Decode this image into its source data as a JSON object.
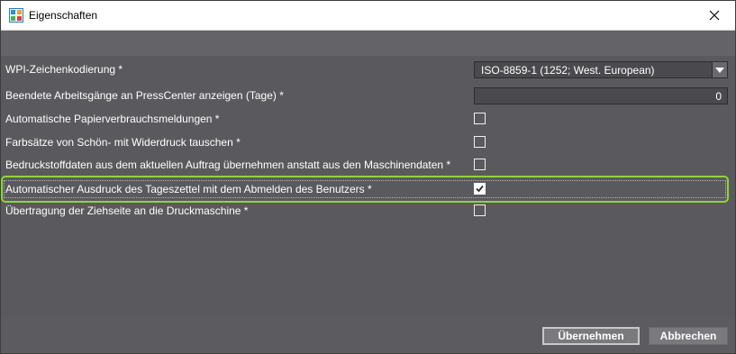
{
  "window": {
    "title": "Eigenschaften"
  },
  "settings": [
    {
      "label": "WPI-Zeichenkodierung *",
      "control": "select",
      "value": "ISO-8859-1 (1252; West. European)"
    },
    {
      "label": "Beendete Arbeitsgänge an PressCenter anzeigen (Tage) *",
      "control": "number",
      "value": "0"
    },
    {
      "label": "Automatische Papierverbrauchsmeldungen *",
      "control": "checkbox",
      "checked": false
    },
    {
      "label": "Farbsätze von Schön- mit Widerdruck tauschen *",
      "control": "checkbox",
      "checked": false
    },
    {
      "label": "Bedruckstoffdaten aus dem aktuellen Auftrag übernehmen anstatt aus den Maschinendaten *",
      "control": "checkbox",
      "checked": false
    },
    {
      "label": "Automatischer Ausdruck des Tageszettel mit dem Abmelden des Benutzers *",
      "control": "checkbox",
      "checked": true,
      "highlighted": true
    },
    {
      "label": "Übertragung der Ziehseite an die Druckmaschine *",
      "control": "checkbox",
      "checked": false
    }
  ],
  "buttons": {
    "apply": "Übernehmen",
    "cancel": "Abbrechen"
  },
  "colors": {
    "highlight": "#8fd43a",
    "background": "#5a5a5e"
  },
  "icons": {
    "app": "properties-app-icon",
    "close": "close-icon",
    "dropdown": "chevron-down-icon",
    "check": "checkmark-icon"
  }
}
